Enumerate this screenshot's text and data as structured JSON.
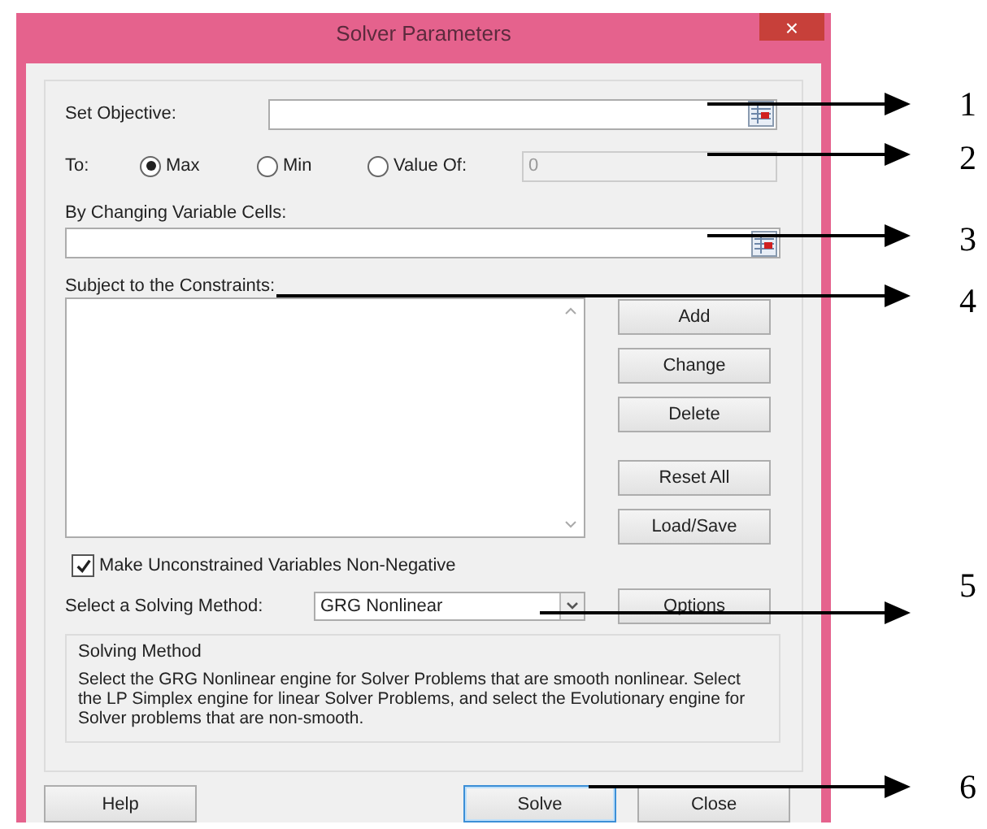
{
  "window": {
    "title": "Solver Parameters",
    "close": "×"
  },
  "objective": {
    "label": "Set Objective:"
  },
  "to": {
    "label": "To:",
    "options": [
      {
        "label": "Max",
        "selected": true
      },
      {
        "label": "Min",
        "selected": false
      },
      {
        "label": "Value Of:",
        "selected": false
      }
    ],
    "value_of": {
      "value": "0",
      "disabled": true
    }
  },
  "changing_cells": {
    "label": "By Changing Variable Cells:"
  },
  "constraints": {
    "label": "Subject to the Constraints:",
    "buttons": [
      "Add",
      "Change",
      "Delete",
      "Reset All",
      "Load/Save"
    ]
  },
  "non_negative": {
    "label": "Make Unconstrained Variables Non-Negative",
    "checked": true
  },
  "method": {
    "label": "Select a Solving Method:",
    "value": "GRG Nonlinear",
    "options_button": "Options"
  },
  "method_group": {
    "title": "Solving Method",
    "text": "Select the GRG Nonlinear engine for Solver Problems that are smooth nonlinear. Select the LP Simplex engine for linear Solver Problems, and select the Evolutionary engine for Solver problems that are non-smooth."
  },
  "bottom_buttons": [
    {
      "label": "Help",
      "default": false
    },
    {
      "label": "Solve",
      "default": true
    },
    {
      "label": "Close",
      "default": false
    }
  ],
  "annotations": [
    "1",
    "2",
    "3",
    "4",
    "5",
    "6"
  ]
}
